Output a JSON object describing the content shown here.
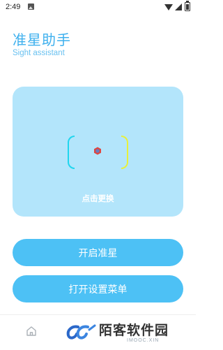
{
  "status_bar": {
    "time": "2:49",
    "icons": [
      "image-notification-icon",
      "wifi-icon",
      "signal-icon",
      "battery-icon"
    ]
  },
  "header": {
    "title": "准星助手",
    "subtitle": "Sight assistant"
  },
  "preview": {
    "change_label": "点击更换",
    "colors": {
      "card_bg": "#b3e5fb",
      "left_bracket": "#1fd6ee",
      "right_bracket": "#e8f03a",
      "crosshair_outer": "#e0453f",
      "crosshair_inner": "#6a7bbf"
    }
  },
  "buttons": {
    "start_label": "开启准星",
    "settings_label": "打开设置菜单"
  },
  "bottom_nav": {
    "items": [
      {
        "icon": "home-icon"
      }
    ]
  },
  "watermark": {
    "text": "陌客软件园",
    "sub": "IMOOC.XIN"
  },
  "theme": {
    "accent": "#3eb0ee",
    "button": "#4dc1f5"
  }
}
